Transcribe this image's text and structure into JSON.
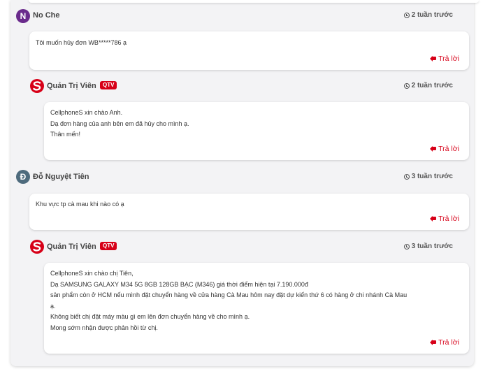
{
  "comments": [
    {
      "author": "No Che",
      "avatar_letter": "N",
      "avatar_color": "#6a2b8c",
      "time": "2 tuần trước",
      "lines": [
        "Tôi muốn hủy đơn WB*****786 ạ"
      ],
      "reply_label": "Trả lời",
      "reply": {
        "author": "Quản Trị Viên",
        "badge": "QTV",
        "time": "2 tuần trước",
        "lines": [
          "CellphoneS xin chào Anh.",
          "Dạ đơn hàng của anh bên em đã hủy cho mình ạ.",
          "Thân mến!"
        ],
        "reply_label": "Trả lời"
      }
    },
    {
      "author": "Đỗ Nguyệt Tiên",
      "avatar_letter": "Đ",
      "avatar_color": "#4e6b7d",
      "time": "3 tuần trước",
      "lines": [
        "Khu vực tp cà mau khi nào có ạ"
      ],
      "reply_label": "Trả lời",
      "reply": {
        "author": "Quản Trị Viên",
        "badge": "QTV",
        "time": "3 tuần trước",
        "lines": [
          "CellphoneS xin chào chị Tiên,",
          "Dạ SAMSUNG GALAXY M34 5G 8GB 128GB BẠC (M346) giá thời điểm hiện tại 7.190.000đ",
          "sản phẩm còn ở HCM nếu mình đặt chuyển hàng về cửa hàng Cà Mau hôm nay đặt dự kiến thứ 6 có hàng ở chi nhánh Cà Mau",
          "ạ.",
          "Không biết chị đặt máy màu gì em lên đơn chuyển hàng về cho mình ạ.",
          "Mong sớm nhận được phản hồi từ chị."
        ],
        "reply_label": "Trả lời"
      }
    }
  ],
  "colors": {
    "accent": "#d70018",
    "panel_bg": "#f3f3f5"
  },
  "icons": {
    "time": "clock-icon",
    "reply": "reply-icon",
    "admin_logo": "cellphones-logo-icon"
  }
}
